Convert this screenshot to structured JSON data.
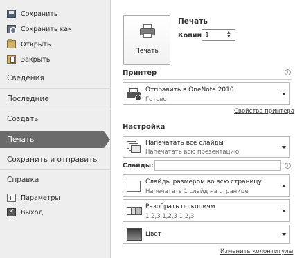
{
  "nav": {
    "save": "Сохранить",
    "save_as": "Сохранить как",
    "open": "Открыть",
    "close": "Закрыть",
    "info": "Сведения",
    "recent": "Последние",
    "create": "Создать",
    "print": "Печать",
    "save_send": "Сохранить и отправить",
    "help": "Справка",
    "params": "Параметры",
    "exit": "Выход"
  },
  "print": {
    "button_label": "Печать",
    "title": "Печать",
    "copies_label": "Копии:",
    "copies_value": "1"
  },
  "printer": {
    "header": "Принтер",
    "name": "Отправить в OneNote 2010",
    "status": "Готово",
    "properties_link": "Свойства принтера"
  },
  "settings": {
    "header": "Настройка",
    "slides_option_title": "Напечатать все слайды",
    "slides_option_sub": "Напечатать всю презентацию",
    "slides_label": "Слайды:",
    "slides_value": "",
    "layout_title": "Слайды размером во всю страницу",
    "layout_sub": "Напечатать 1 слайд на странице",
    "collate_title": "Разобрать по копиям",
    "collate_sub": "1,2,3   1,2,3   1,2,3",
    "color_title": "Цвет",
    "header_footer_link": "Изменить колонтитулы"
  },
  "icons": {
    "save": "save-icon",
    "save_as": "save-as-icon",
    "open": "open-folder-icon",
    "close": "close-document-icon",
    "params": "options-icon",
    "exit": "exit-icon",
    "printer": "printer-icon",
    "info": "info-icon"
  }
}
